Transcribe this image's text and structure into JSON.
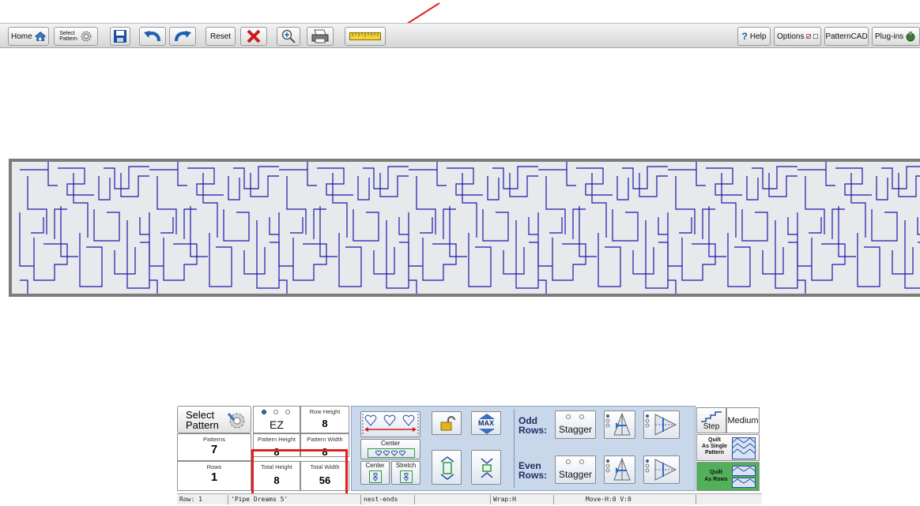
{
  "toolbar": {
    "home_label": "Home",
    "select_pattern_line1": "Select",
    "select_pattern_line2": "Pattern",
    "reset_label": "Reset",
    "help_label": "Help",
    "options_label": "Options",
    "patterncad_label": "PatternCAD",
    "plugins_label": "Plug-ins"
  },
  "panel": {
    "select_pattern_line1": "Select",
    "select_pattern_line2": "Pattern",
    "patterns_label": "Patterns",
    "patterns_value": "7",
    "rows_label": "Rows",
    "rows_value": "1",
    "ez_label": "EZ",
    "row_height_label": "Row Height",
    "row_height_value": "8",
    "pattern_height_label": "Pattern Height",
    "pattern_height_value": "8",
    "pattern_width_label": "Pattern Width",
    "pattern_width_value": "8",
    "total_height_label": "Total Height",
    "total_height_value": "8",
    "total_width_label": "Total Width",
    "total_width_value": "56",
    "center_label": "Center",
    "center2_label": "Center",
    "stretch_label": "Stretch",
    "max_label": "MAX",
    "odd_line1": "Odd",
    "odd_line2": "Rows:",
    "even_line1": "Even",
    "even_line2": "Rows:",
    "stagger_odd": "Stagger",
    "stagger_even": "Stagger",
    "step_label": "Step",
    "medium_label": "Medium",
    "quilt_single_line1": "Quilt",
    "quilt_single_line2": "As Single",
    "quilt_single_line3": "Pattern",
    "quilt_rows_line1": "Quilt",
    "quilt_rows_line2": "As Rows"
  },
  "status": {
    "row": "Row: 1",
    "pattern_name": "'Pipe Dreams 5'",
    "nest": "nest-ends",
    "wrap": "Wrap:H",
    "move": "Move-H:0 V:0"
  },
  "colors": {
    "pattern_stroke": "#1a1aa8",
    "canvas_bg": "#e7e9ec",
    "highlight_red": "#e02020"
  }
}
